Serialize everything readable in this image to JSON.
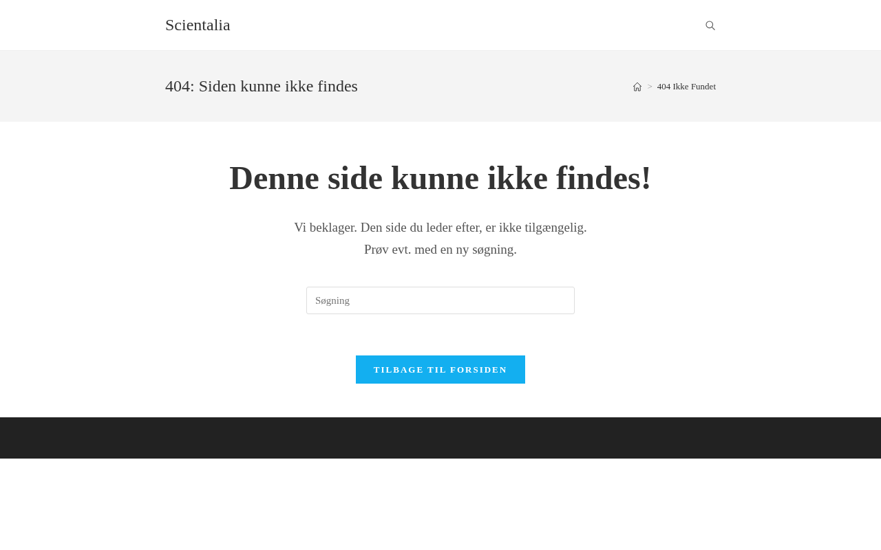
{
  "header": {
    "site_title": "Scientalia"
  },
  "page_header": {
    "title": "404: Siden kunne ikke findes",
    "breadcrumb": {
      "separator": ">",
      "current": "404 Ikke Fundet"
    }
  },
  "content": {
    "heading": "Denne side kunne ikke findes!",
    "message_lines": [
      "Vi beklager. Den side du leder efter, er ikke tilgængelig.",
      "Prøv evt. med en ny søgning."
    ],
    "search": {
      "placeholder": "Søgning"
    },
    "button": "TILBAGE TIL FORSIDEN"
  }
}
